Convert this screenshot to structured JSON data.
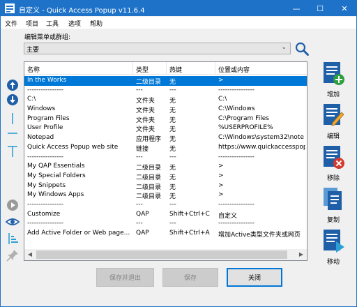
{
  "window": {
    "title": "自定义 - Quick Access Popup v11.6.4",
    "controls": {
      "minimize": "—",
      "maximize": "☐",
      "close": "✕"
    }
  },
  "menubar": [
    "文件",
    "项目",
    "工具",
    "选项",
    "帮助"
  ],
  "group_label": "编辑菜单或群组:",
  "group_select": {
    "value": "主要"
  },
  "list": {
    "columns": [
      "名称",
      "类型",
      "热键",
      "位置或内容"
    ],
    "rows": [
      {
        "name": "In the Works",
        "type": "二级目录",
        "hotkey": "无",
        "location": ">",
        "selected": true
      },
      {
        "name": "----------------",
        "type": "---",
        "hotkey": "---",
        "location": "----------------"
      },
      {
        "name": "C:\\",
        "type": "文件夹",
        "hotkey": "无",
        "location": "C:\\"
      },
      {
        "name": "Windows",
        "type": "文件夹",
        "hotkey": "无",
        "location": "C:\\Windows"
      },
      {
        "name": "Program Files",
        "type": "文件夹",
        "hotkey": "无",
        "location": "C:\\Program Files"
      },
      {
        "name": "User Profile",
        "type": "文件夹",
        "hotkey": "无",
        "location": "%USERPROFILE%"
      },
      {
        "name": "Notepad",
        "type": "应用程序",
        "hotkey": "无",
        "location": "C:\\Windows\\system32\\note"
      },
      {
        "name": "Quick Access Popup web site",
        "type": "链接",
        "hotkey": "无",
        "location": "https://www.quickaccesspop"
      },
      {
        "name": "----------------",
        "type": "---",
        "hotkey": "---",
        "location": "----------------"
      },
      {
        "name": "My QAP Essentials",
        "type": "二级目录",
        "hotkey": "无",
        "location": ">"
      },
      {
        "name": "My Special Folders",
        "type": "二级目录",
        "hotkey": "无",
        "location": ">"
      },
      {
        "name": "My Snippets",
        "type": "二级目录",
        "hotkey": "无",
        "location": ">"
      },
      {
        "name": "My Windows Apps",
        "type": "二级目录",
        "hotkey": "无",
        "location": ">"
      },
      {
        "name": "----------------",
        "type": "---",
        "hotkey": "---",
        "location": "----------------"
      },
      {
        "name": "Customize",
        "type": "QAP",
        "hotkey": "Shift+Ctrl+C",
        "location": "自定义"
      },
      {
        "name": "----------------",
        "type": "---",
        "hotkey": "---",
        "location": "----------------"
      },
      {
        "name": "Add Active Folder or Web page...",
        "type": "QAP",
        "hotkey": "Shift+Ctrl+A",
        "location": "增加Active类型文件夹或网页"
      }
    ]
  },
  "side_actions": [
    "增加",
    "编辑",
    "移除",
    "复制",
    "移动"
  ],
  "buttons": {
    "save_exit": "保存并退出",
    "save": "保存",
    "close": "关闭"
  },
  "colors": {
    "titlebar": "#1e73c9",
    "selection": "#0078d7",
    "icon_blue": "#1f5fa8",
    "add_green": "#2e9f3e",
    "remove_red": "#d23a2e"
  }
}
